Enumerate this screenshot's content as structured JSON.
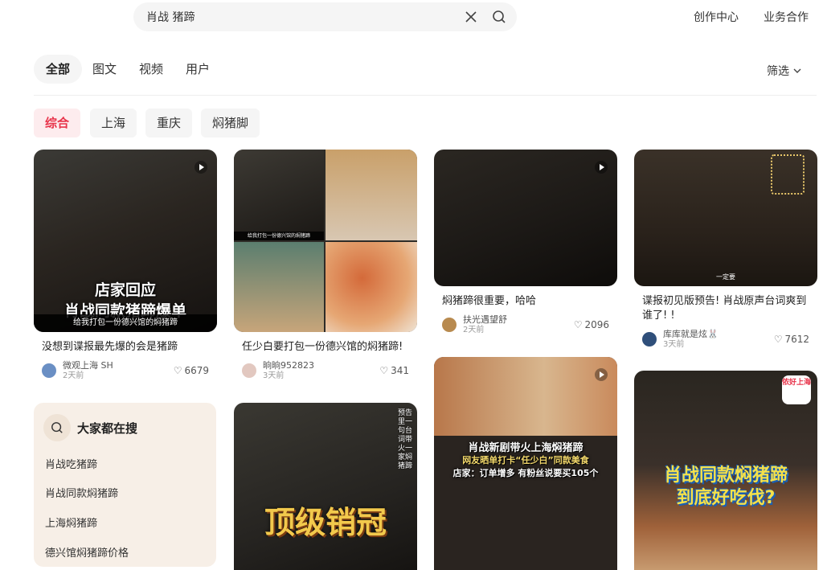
{
  "search": {
    "value": "肖战 猪蹄"
  },
  "top_links": [
    "创作中心",
    "业务合作"
  ],
  "tabs": [
    "全部",
    "图文",
    "视频",
    "用户"
  ],
  "filter_label": "筛选",
  "chips": [
    "综合",
    "上海",
    "重庆",
    "焖猪脚"
  ],
  "cards": [
    {
      "title": "没想到谍报最先爆的会是猪蹄",
      "author": "微观上海 SH",
      "time": "2天前",
      "likes": "6679",
      "overlay_line1": "店家回应",
      "overlay_line2": "肖战同款猪蹄爆单",
      "subtitle": "给我打包一份德兴馆的焖猪蹄"
    },
    {
      "title": "任少白要打包一份德兴馆的焖猪蹄!",
      "author": "晌晌952823",
      "time": "3天前",
      "likes": "341",
      "subtitle": "给我打包一份德兴馆的焖猪蹄"
    },
    {
      "title": "焖猪蹄很重要，哈哈",
      "author": "扶光遇望舒",
      "time": "2天前",
      "likes": "2096"
    },
    {
      "title": "谍报初见版预告! 肖战原声台词爽到谁了! !",
      "author": "库库就是炫🐰",
      "time": "3天前",
      "likes": "7612",
      "subtitle": "一定要"
    },
    {
      "overlay_text": "顶级销冠",
      "side_text": "预告里一句台词带火一家焖猪蹄"
    },
    {
      "overlay_line1": "肖战新剧带火上海焖猪蹄",
      "overlay_line2": "网友晒单打卡“任少白”同款美食",
      "overlay_line3": "店家：订单增多 有粉丝说要买105个"
    },
    {
      "overlay_line1": "肖战同款焖猪蹄",
      "overlay_line2": "到底好吃伐?",
      "badge": "侬好上海"
    }
  ],
  "trending": {
    "title": "大家都在搜",
    "items": [
      "肖战吃猪蹄",
      "肖战同款焖猪蹄",
      "上海焖猪蹄",
      "德兴馆焖猪蹄价格"
    ]
  },
  "colors": {
    "accent": "#e8334a",
    "chip_bg": "#f5f5f5",
    "trending_bg": "#f7efe7"
  }
}
